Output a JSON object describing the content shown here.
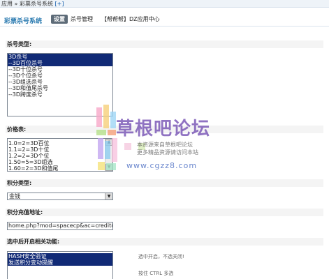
{
  "breadcrumb": {
    "text": "应用 » 彩票杀号系统",
    "add": "[+]"
  },
  "header": {
    "app_title": "彩票杀号系统",
    "nav": [
      {
        "label": "设置",
        "active": true
      },
      {
        "label": "杀号管理",
        "active": false
      },
      {
        "label": "【帮帮帮】DZ应用中心",
        "active": false
      }
    ]
  },
  "form": {
    "kill_type": {
      "label": "杀号类型:",
      "options": [
        {
          "text": "3D杀号",
          "selected": true
        },
        {
          "text": "--3D百位杀号",
          "selected": true
        },
        {
          "text": "--3D十位杀号",
          "selected": false
        },
        {
          "text": "--3D个位杀号",
          "selected": false
        },
        {
          "text": "--3D组选杀号",
          "selected": false
        },
        {
          "text": "--3D和值尾杀号",
          "selected": false
        },
        {
          "text": "--3D跨度杀号",
          "selected": false
        }
      ]
    },
    "price": {
      "label": "价格表:",
      "options": [
        {
          "text": "1.0=2=3D百位"
        },
        {
          "text": "1.1=2=3D十位"
        },
        {
          "text": "1.2=2=3D个位"
        },
        {
          "text": "1.50=5=3D组选"
        },
        {
          "text": "1.60=2=3D和值尾"
        }
      ]
    },
    "credit_type": {
      "label": "积分类型:",
      "value": "金钱"
    },
    "recharge_url": {
      "label": "积分充值地址:",
      "value": "home.php?mod=spacecp&ac=credit&op"
    },
    "features": {
      "label": "选中后开启相关功能:",
      "options": [
        {
          "text": "HASH安全验证",
          "selected": true
        },
        {
          "text": "发送积分变动提醒",
          "selected": true
        }
      ],
      "hint_select": "选中开启，不选关闭!",
      "hint_ctrl": "按住 CTRL 多选"
    }
  },
  "watermark": {
    "title": "草根吧论坛",
    "url": "www.cgzz8.com",
    "line1": "本资源来自草根吧论坛",
    "line2": "更多精品资源请访问本站"
  },
  "colors": {
    "accent": "#2a7ab0",
    "selection": "#112a76",
    "nav_active": "#5d6b78"
  }
}
